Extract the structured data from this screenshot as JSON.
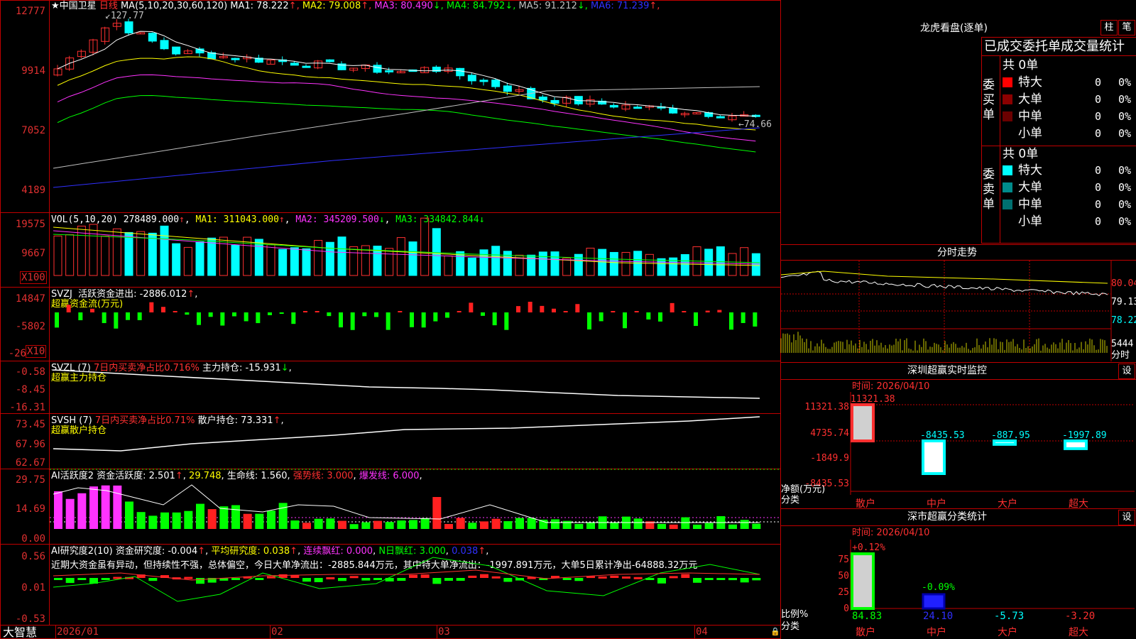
{
  "main_chart": {
    "stock_name": "中国卫星",
    "period": "日线",
    "ma_header": "MA(5,10,20,30,60,120)",
    "ma_values": [
      {
        "label": "MA1:",
        "value": "78.222",
        "arrow": "↑",
        "color": "#ffffff"
      },
      {
        "label": "MA2:",
        "value": "79.008",
        "arrow": "↑",
        "color": "#ffff00"
      },
      {
        "label": "MA3:",
        "value": "80.490",
        "arrow": "↓",
        "color": "#ff33ff"
      },
      {
        "label": "MA4:",
        "value": "84.792",
        "arrow": "↓",
        "color": "#00ff00"
      },
      {
        "label": "MA5:",
        "value": "91.212",
        "arrow": "↓",
        "color": "#c0c0c0"
      },
      {
        "label": "MA6:",
        "value": "71.239",
        "arrow": "↑",
        "color": "#3030ff"
      }
    ],
    "y_ticks": [
      "12777",
      "9914",
      "7052",
      "4189"
    ],
    "high_label": "127.77",
    "low_label": "74.66"
  },
  "vol_panel": {
    "title": "VOL(5,10,20)",
    "value": "278489.000",
    "ma1": "MA1: 311043.000",
    "ma2": "MA2: 345209.500",
    "ma3": "MA3: 334842.844",
    "y_ticks": [
      "19575",
      "9667"
    ],
    "unit": "X100"
  },
  "svzj_panel": {
    "title": "SVZJ",
    "text1": "活跃资金进出: -2886.012",
    "subtitle": "超赢资金流(万元)",
    "y_ticks": [
      "14847",
      "-5802",
      "-26"
    ],
    "unit": "X10"
  },
  "svzl_panel": {
    "title": "SVZL (7)",
    "text1": "7日内买卖净占比0.716%",
    "text2": "主力持仓: -15.931",
    "subtitle": "超赢主力持仓",
    "y_ticks": [
      "-0.58",
      "-8.45",
      "-16.31"
    ]
  },
  "svsh_panel": {
    "title": "SVSH (7)",
    "text1": "7日内买卖净占比0.71%",
    "text2": "散户持仓: 73.331",
    "subtitle": "超赢散户持仓",
    "y_ticks": [
      "73.45",
      "67.96",
      "62.67"
    ]
  },
  "ai_active_panel": {
    "title": "AI活跃度2",
    "text1": "资金活跃度: 2.501",
    "text2": "29.748",
    "text3": "生命线: 1.560",
    "text4": "强势线: 3.000",
    "text5": "爆发线: 6.000",
    "y_ticks": [
      "29.75",
      "14.69",
      "0.00"
    ]
  },
  "ai_research_panel": {
    "title": "AI研究度2(10)",
    "text1": "资金研究度: -0.004",
    "text2": "平均研究度: 0.038",
    "text3": "连续飘红: 0.000",
    "text4": "N日飘红: 3.000",
    "text5": "0.038",
    "summary": "近期大资金虽有异动，但持续性不强，总体偏空，今日大单净流出：-2885.844万元，其中特大单净流出：-1997.891万元，大单5日累计净出-64888.32万元",
    "y_ticks": [
      "0.56",
      "0.01",
      "-0.53"
    ]
  },
  "date_axis": [
    "2026/01",
    "02",
    "03",
    "04"
  ],
  "brand": "大智慧",
  "dragon_tiger": {
    "title": "龙虎看盘(逐单)",
    "btn1": "柱",
    "btn2": "笔",
    "header": "已成交委托单成交量统计",
    "buy_label": "委买单",
    "sell_label": "委卖单",
    "buy_total": "共 0单",
    "sell_total": "共 0单",
    "buy_rows": [
      {
        "name": "特大",
        "count": "0",
        "pct": "0%",
        "color": "#ff0000"
      },
      {
        "name": "大单",
        "count": "0",
        "pct": "0%",
        "color": "#8b0000"
      },
      {
        "name": "中单",
        "count": "0",
        "pct": "0%",
        "color": "#6b0000"
      },
      {
        "name": "小单",
        "count": "0",
        "pct": "0%",
        "color": "#000000"
      }
    ],
    "sell_rows": [
      {
        "name": "特大",
        "count": "0",
        "pct": "0%",
        "color": "#00ffff"
      },
      {
        "name": "大单",
        "count": "0",
        "pct": "0%",
        "color": "#008b8b"
      },
      {
        "name": "中单",
        "count": "0",
        "pct": "0%",
        "color": "#007070"
      },
      {
        "name": "小单",
        "count": "0",
        "pct": "0%",
        "color": "#000000"
      }
    ]
  },
  "intraday": {
    "title": "分时走势",
    "prices": [
      "80.04",
      "79.13",
      "78.22"
    ],
    "volume": "5444",
    "vol_label": "分时"
  },
  "sz_monitor": {
    "title": "深圳超赢实时监控",
    "btn": "设",
    "time": "时间: 2026/04/10",
    "y_ticks": [
      "11321.38",
      "4735.74",
      "-1849.9",
      "-8435.53"
    ],
    "unit_label": "净额(万元)",
    "cat_label": "分类",
    "categories": [
      "散户",
      "中户",
      "大户",
      "超大"
    ],
    "values": [
      "11321.38",
      "-8435.53",
      "-887.95",
      "-1997.89"
    ]
  },
  "sz_classify": {
    "title": "深市超赢分类统计",
    "btn": "设",
    "time": "时间: 2026/04/10",
    "y_ticks": [
      "75",
      "50",
      "25",
      "0"
    ],
    "ratio_label": "比例%",
    "cat_label": "分类",
    "categories": [
      "散户",
      "中户",
      "大户",
      "超大"
    ],
    "bar_labels": [
      "+0.12%",
      "-0.09%"
    ],
    "bottom_values": [
      "84.83",
      "24.10",
      "-5.73",
      "-3.20"
    ]
  }
}
